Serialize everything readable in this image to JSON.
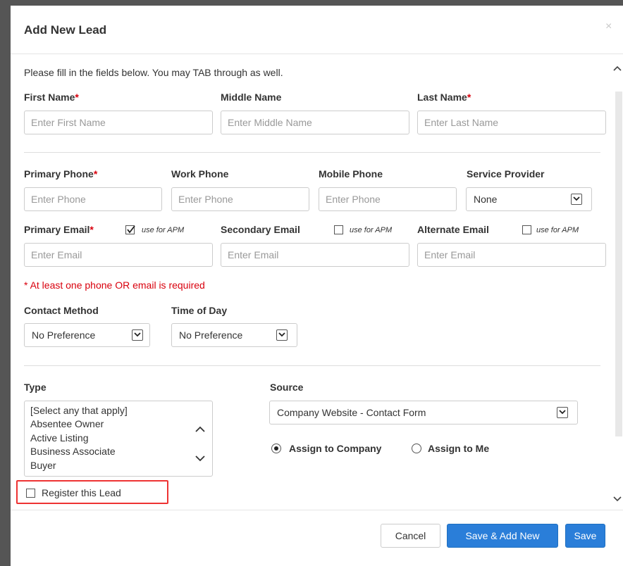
{
  "modal": {
    "title": "Add New Lead",
    "close_glyph": "×",
    "intro": "Please fill in the fields below. You may TAB through as well."
  },
  "name": {
    "first_label": "First Name",
    "first_placeholder": "Enter First Name",
    "middle_label": "Middle Name",
    "middle_placeholder": "Enter Middle Name",
    "last_label": "Last Name",
    "last_placeholder": "Enter Last Name",
    "required_mark": "*"
  },
  "phone": {
    "primary_label": "Primary Phone",
    "primary_placeholder": "Enter Phone",
    "work_label": "Work Phone",
    "work_placeholder": "Enter Phone",
    "mobile_label": "Mobile Phone",
    "mobile_placeholder": "Enter Phone",
    "provider_label": "Service Provider",
    "provider_value": "None"
  },
  "email": {
    "primary_label": "Primary Email",
    "primary_placeholder": "Enter Email",
    "primary_apm_checked": true,
    "secondary_label": "Secondary Email",
    "secondary_placeholder": "Enter Email",
    "secondary_apm_checked": false,
    "alternate_label": "Alternate Email",
    "alternate_placeholder": "Enter Email",
    "alternate_apm_checked": false,
    "apm_label": "use for APM"
  },
  "requirement_note": "* At least one phone OR email is required",
  "preferences": {
    "contact_method_label": "Contact Method",
    "contact_method_value": "No Preference",
    "time_of_day_label": "Time of Day",
    "time_of_day_value": "No Preference"
  },
  "type": {
    "label": "Type",
    "options": [
      "[Select any that apply]",
      "Absentee Owner",
      "Active Listing",
      "Business Associate",
      "Buyer"
    ]
  },
  "source": {
    "label": "Source",
    "value": "Company Website - Contact Form"
  },
  "assign": {
    "company_label": "Assign to Company",
    "company_selected": true,
    "me_label": "Assign to Me",
    "me_selected": false
  },
  "register": {
    "label": "Register this Lead",
    "checked": false
  },
  "footer": {
    "cancel_label": "Cancel",
    "save_add_new_label": "Save & Add New",
    "save_label": "Save"
  },
  "colors": {
    "required": "#d9000d",
    "primary_button": "#2a7ed9",
    "highlight_box": "#e33333"
  }
}
